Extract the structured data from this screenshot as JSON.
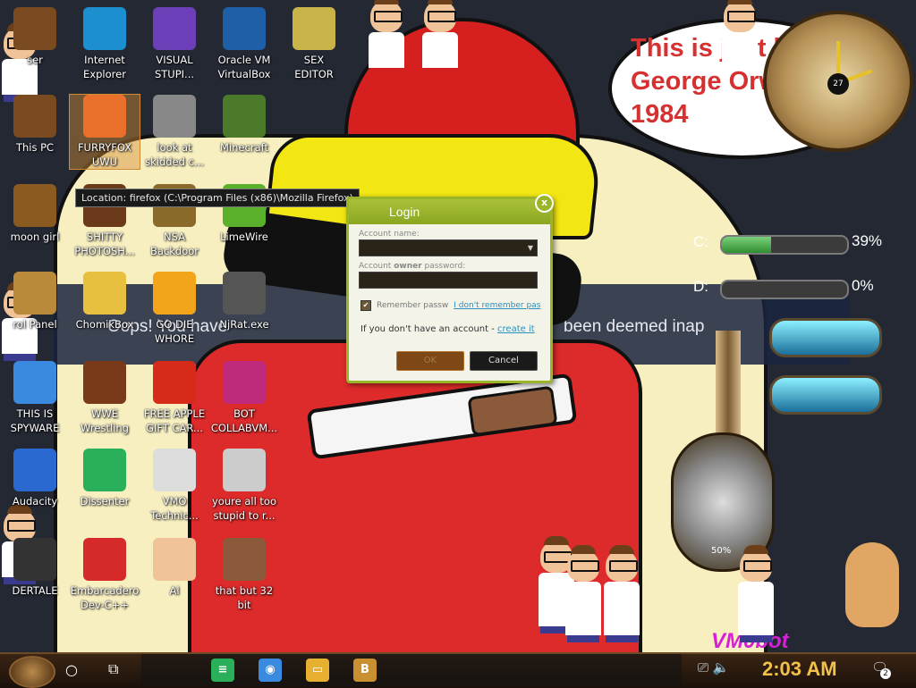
{
  "wallpaper": {
    "speech_bubble": "This is just like George Orwell's 1984",
    "banner_left": "Oops! You have",
    "banner_right": "been deemed inap",
    "bottom_text": "VM0bot"
  },
  "desktop_icons": [
    {
      "label": "ser",
      "icon": "user-folder-icon",
      "color": "#7a4a20"
    },
    {
      "label": "Internet\nExplorer",
      "icon": "edge-icon",
      "color": "#1b8fd0"
    },
    {
      "label": "VISUAL\nSTUPI...",
      "icon": "visual-studio-icon",
      "color": "#6c3fb8"
    },
    {
      "label": "Oracle VM\nVirtualBox",
      "icon": "virtualbox-icon",
      "color": "#1f5fa8"
    },
    {
      "label": "SEX\nEDITOR",
      "icon": "hex-editor-icon",
      "color": "#c9b44a"
    },
    {
      "label": "This PC",
      "icon": "computer-icon",
      "color": "#7a4a20"
    },
    {
      "label": "FURRYFOX\nUWU",
      "icon": "firefox-icon",
      "color": "#e8702a"
    },
    {
      "label": "look at\nskidded c...",
      "icon": "copy-icon",
      "color": "#888888"
    },
    {
      "label": "Minecraft",
      "icon": "minecraft-icon",
      "color": "#4a7a2a"
    },
    {
      "label": "moon girl",
      "icon": "box-icon",
      "color": "#8a5a20"
    },
    {
      "label": "SHITTY\nPHOTOSH...",
      "icon": "photoshop-icon",
      "color": "#6a3a1a"
    },
    {
      "label": "NSA\nBackdoor",
      "icon": "folder-icon",
      "color": "#8a6a2a"
    },
    {
      "label": "LimeWire",
      "icon": "limewire-icon",
      "color": "#5ab02a"
    },
    {
      "label": "rol Panel",
      "icon": "control-panel-icon",
      "color": "#b88a3a"
    },
    {
      "label": "ChomikBox",
      "icon": "chomikbox-icon",
      "color": "#e8c040"
    },
    {
      "label": "GO DIE\nWHORE",
      "icon": "dev-editor-icon",
      "color": "#f2a41a"
    },
    {
      "label": "NjRat.exe",
      "icon": "skull-icon",
      "color": "#555555"
    },
    {
      "label": "THIS IS\nSPYWARE",
      "icon": "chrome-icon",
      "color": "#3a8ae0"
    },
    {
      "label": "WWE\nWrestling",
      "icon": "tv-icon",
      "color": "#7a3a1a"
    },
    {
      "label": "FREE APPLE\nGIFT CAR...",
      "icon": "apple-icon",
      "color": "#d62a1a"
    },
    {
      "label": "BOT\nCOLLABVM...",
      "icon": "monitor-icon",
      "color": "#c02a7a"
    },
    {
      "label": "Audacity",
      "icon": "audacity-icon",
      "color": "#2a6ad0"
    },
    {
      "label": "Dissenter",
      "icon": "dissenter-icon",
      "color": "#2ab05a"
    },
    {
      "label": "VMO\nTechnic...",
      "icon": "doctor-icon",
      "color": "#dddddd"
    },
    {
      "label": "youre all too\nstupid to r...",
      "icon": "portrait-icon",
      "color": "#cccccc"
    },
    {
      "label": "DERTALE",
      "icon": "unity-icon",
      "color": "#333333"
    },
    {
      "label": "Embarcadero\nDev-C++",
      "icon": "devcpp-icon",
      "color": "#d62a2a"
    },
    {
      "label": "Al",
      "icon": "character-icon",
      "color": "#f0c498"
    },
    {
      "label": "that but 32\nbit",
      "icon": "painting-icon",
      "color": "#8a5a3a"
    }
  ],
  "tooltip": "Location: firefox (C:\\Program Files (x86)\\Mozilla Firefox)",
  "login": {
    "title": "Login",
    "account_name_label": "Account name:",
    "password_label_pre": "Account ",
    "password_label_bold": "owner",
    "password_label_post": " password:",
    "remember_label": "Remember passw",
    "forgot_link": "I don't remember pas",
    "no_account_text": "If you don't have an account - ",
    "create_link": "create it",
    "ok_button": "OK",
    "cancel_button": "Cancel",
    "close_glyph": "x",
    "check_glyph": "✔",
    "dropdown_glyph": "▼"
  },
  "widgets": {
    "disk_c": {
      "label": "C:",
      "percent": 39,
      "percent_text": "39%"
    },
    "disk_d": {
      "label": "D:",
      "percent": 0,
      "percent_text": "0%"
    },
    "clock_date": "27",
    "gauge_percent": "50%"
  },
  "taskbar": {
    "time": "2:03 AM",
    "notification_count": "2",
    "search_glyph": "○",
    "taskview_glyph": "⧉",
    "tray_network_glyph": "⎚",
    "tray_volume_glyph": "🔈",
    "notification_glyph": "🗨",
    "apps": [
      {
        "name": "Dissenter",
        "icon": "dissenter-taskbar-icon",
        "glyph": "≡",
        "color": "#2ab05a"
      },
      {
        "name": "Chrome",
        "icon": "chrome-taskbar-icon",
        "glyph": "◉",
        "color": "#3a8ae0"
      },
      {
        "name": "File Explorer",
        "icon": "folder-taskbar-icon",
        "glyph": "▭",
        "color": "#e8b030"
      },
      {
        "name": "ChomikBox",
        "icon": "chomikbox-taskbar-icon",
        "glyph": "B",
        "color": "#c89030"
      }
    ]
  }
}
